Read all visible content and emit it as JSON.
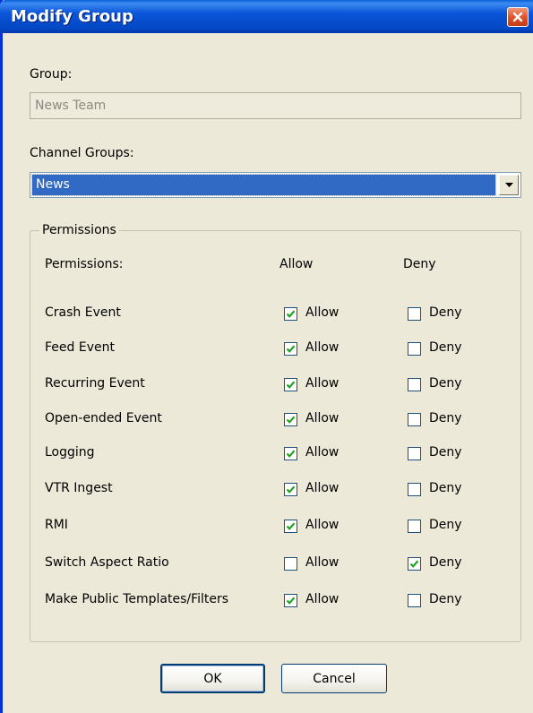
{
  "window": {
    "title": "Modify Group"
  },
  "group": {
    "label": "Group:",
    "value": "News Team"
  },
  "channel_groups": {
    "label": "Channel Groups:",
    "selected": "News"
  },
  "permissions": {
    "legend": "Permissions",
    "header": {
      "name": "Permissions:",
      "allow": "Allow",
      "deny": "Deny"
    },
    "rows": [
      {
        "name": "Crash Event",
        "allow_label": "Allow",
        "deny_label": "Deny",
        "allow": true,
        "deny": false
      },
      {
        "name": "Feed Event",
        "allow_label": "Allow",
        "deny_label": "Deny",
        "allow": true,
        "deny": false
      },
      {
        "name": "Recurring Event",
        "allow_label": "Allow",
        "deny_label": "Deny",
        "allow": true,
        "deny": false
      },
      {
        "name": "Open-ended Event",
        "allow_label": "Allow",
        "deny_label": "Deny",
        "allow": true,
        "deny": false
      },
      {
        "name": "Logging",
        "allow_label": "Allow",
        "deny_label": "Deny",
        "allow": true,
        "deny": false
      },
      {
        "name": "VTR Ingest",
        "allow_label": "Allow",
        "deny_label": "Deny",
        "allow": true,
        "deny": false
      },
      {
        "name": "RMI",
        "allow_label": "Allow",
        "deny_label": "Deny",
        "allow": true,
        "deny": false
      },
      {
        "name": "Switch Aspect Ratio",
        "allow_label": "Allow",
        "deny_label": "Deny",
        "allow": false,
        "deny": true
      },
      {
        "name": "Make Public Templates/Filters",
        "allow_label": "Allow",
        "deny_label": "Deny",
        "allow": true,
        "deny": false
      }
    ]
  },
  "buttons": {
    "ok": "OK",
    "cancel": "Cancel"
  },
  "colors": {
    "titlebar": "#0348c4",
    "selection": "#316ac5",
    "dialog_bg": "#ece9d8",
    "check": "#21a121"
  }
}
